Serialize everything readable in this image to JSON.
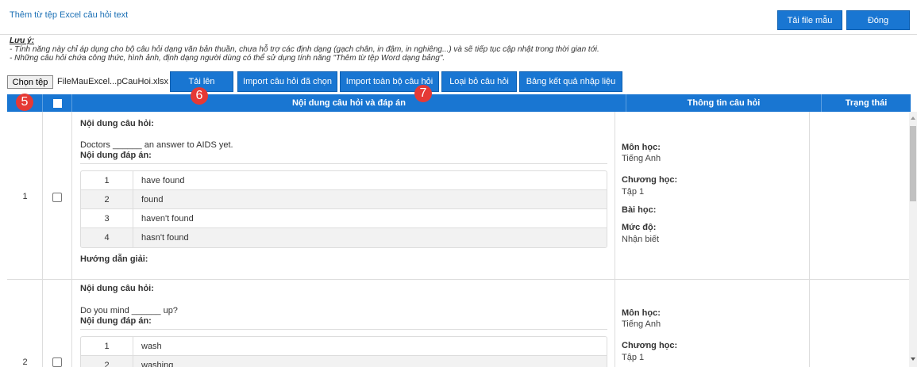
{
  "header": {
    "title": "Thêm từ tệp Excel câu hỏi text",
    "sample_button": "Tải file mẫu",
    "close_button": "Đóng"
  },
  "note": {
    "title": "Lưu ý:",
    "line1": "- Tính năng này chỉ áp dụng cho bộ câu hỏi dạng văn bản thuần, chưa hỗ trợ các định dạng (gạch chân, in đậm, in nghiêng...) và sẽ tiếp tục cập nhật trong thời gian tới.",
    "line2": "- Những câu hỏi chứa công thức, hình ảnh, định dạng người dùng có thể sử dụng tính năng \"Thêm từ tệp Word dạng bảng\"."
  },
  "toolbar": {
    "choose_file": "Chọn tệp",
    "file_name": "FileMauExcel...pCauHoi.xlsx",
    "upload": "Tải lên",
    "import_selected": "Import câu hỏi đã chọn",
    "import_all": "Import toàn bộ câu hỏi",
    "remove": "Loại bỏ câu hỏi",
    "result_table": "Bảng kết quả nhập liệu"
  },
  "markers": {
    "m5": "5",
    "m6": "6",
    "m7": "7"
  },
  "table": {
    "col_content": "Nội dung câu hỏi và đáp án",
    "col_info": "Thông tin câu hỏi",
    "col_status": "Trạng thái"
  },
  "labels": {
    "question": "Nội dung câu hỏi:",
    "answers": "Nội dung đáp án:",
    "guide": "Hướng dẫn giải:",
    "subject": "Môn học:",
    "chapter": "Chương học:",
    "lesson": "Bài học:",
    "level": "Mức độ:"
  },
  "rows": [
    {
      "stt": "1",
      "question": "Doctors ______ an answer to AIDS yet.",
      "answers": [
        {
          "num": "1",
          "text": "have found"
        },
        {
          "num": "2",
          "text": "found"
        },
        {
          "num": "3",
          "text": "haven't found"
        },
        {
          "num": "4",
          "text": "hasn't found"
        }
      ],
      "subject": "Tiếng Anh",
      "chapter": "Tập 1",
      "level": "Nhận biết"
    },
    {
      "stt": "2",
      "question": "Do you mind ______ up?",
      "answers": [
        {
          "num": "1",
          "text": "wash"
        },
        {
          "num": "2",
          "text": "washing"
        }
      ],
      "subject": "Tiếng Anh",
      "chapter": "Tập 1"
    }
  ],
  "colors": {
    "primary": "#1976d2",
    "marker": "#e53935",
    "title": "#1a6fb5"
  }
}
